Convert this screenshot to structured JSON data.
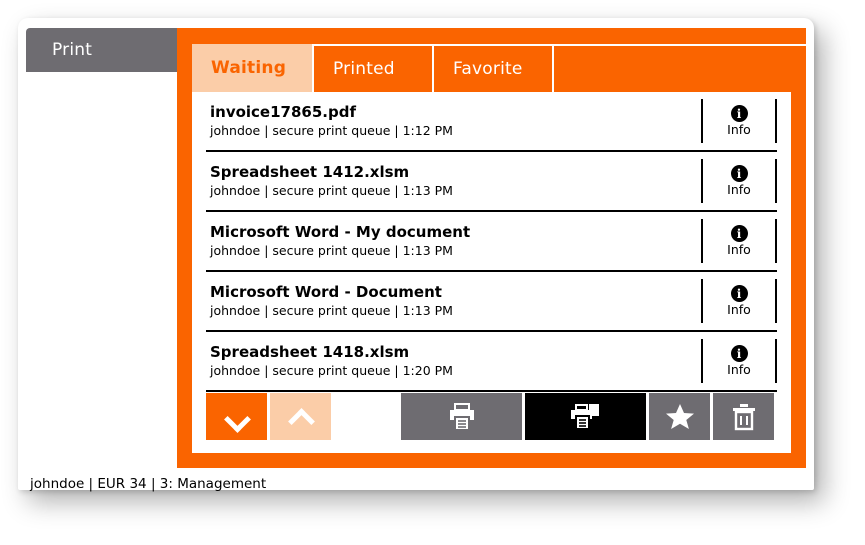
{
  "window": {
    "header_tab_label": "Print",
    "accent_color": "#fa6400",
    "accent_light_color": "#fbcda8",
    "header_tab_color": "#6e6c71"
  },
  "tabs": [
    {
      "label": "Waiting",
      "active": true
    },
    {
      "label": "Printed",
      "active": false
    },
    {
      "label": "Favorite",
      "active": false
    }
  ],
  "job_list": {
    "info_label": "Info",
    "info_icon": "info-circle-icon",
    "rows": [
      {
        "title": "invoice17865.pdf",
        "meta": "johndoe | secure print queue | 1:12 PM"
      },
      {
        "title": "Spreadsheet 1412.xlsm",
        "meta": "johndoe | secure print queue | 1:13 PM"
      },
      {
        "title": "Microsoft Word - My document",
        "meta": "johndoe | secure print queue | 1:13 PM"
      },
      {
        "title": "Microsoft Word - Document",
        "meta": "johndoe | secure print queue | 1:13 PM"
      },
      {
        "title": "Spreadsheet 1418.xlsm",
        "meta": "johndoe | secure print queue | 1:20 PM"
      }
    ]
  },
  "action_bar": {
    "buttons": [
      {
        "name": "scroll-down-button",
        "icon": "chevron-down-icon",
        "style": "orange"
      },
      {
        "name": "scroll-up-button",
        "icon": "chevron-up-icon",
        "style": "peach"
      },
      {
        "name": "print-button",
        "icon": "printer-icon",
        "style": "gray"
      },
      {
        "name": "print-and-keep-button",
        "icon": "printer-copy-icon",
        "style": "black"
      },
      {
        "name": "favorite-button",
        "icon": "star-icon",
        "style": "gray"
      },
      {
        "name": "delete-button",
        "icon": "trash-icon",
        "style": "gray"
      }
    ]
  },
  "status_bar": {
    "text": "johndoe | EUR 34 | 3: Management"
  }
}
